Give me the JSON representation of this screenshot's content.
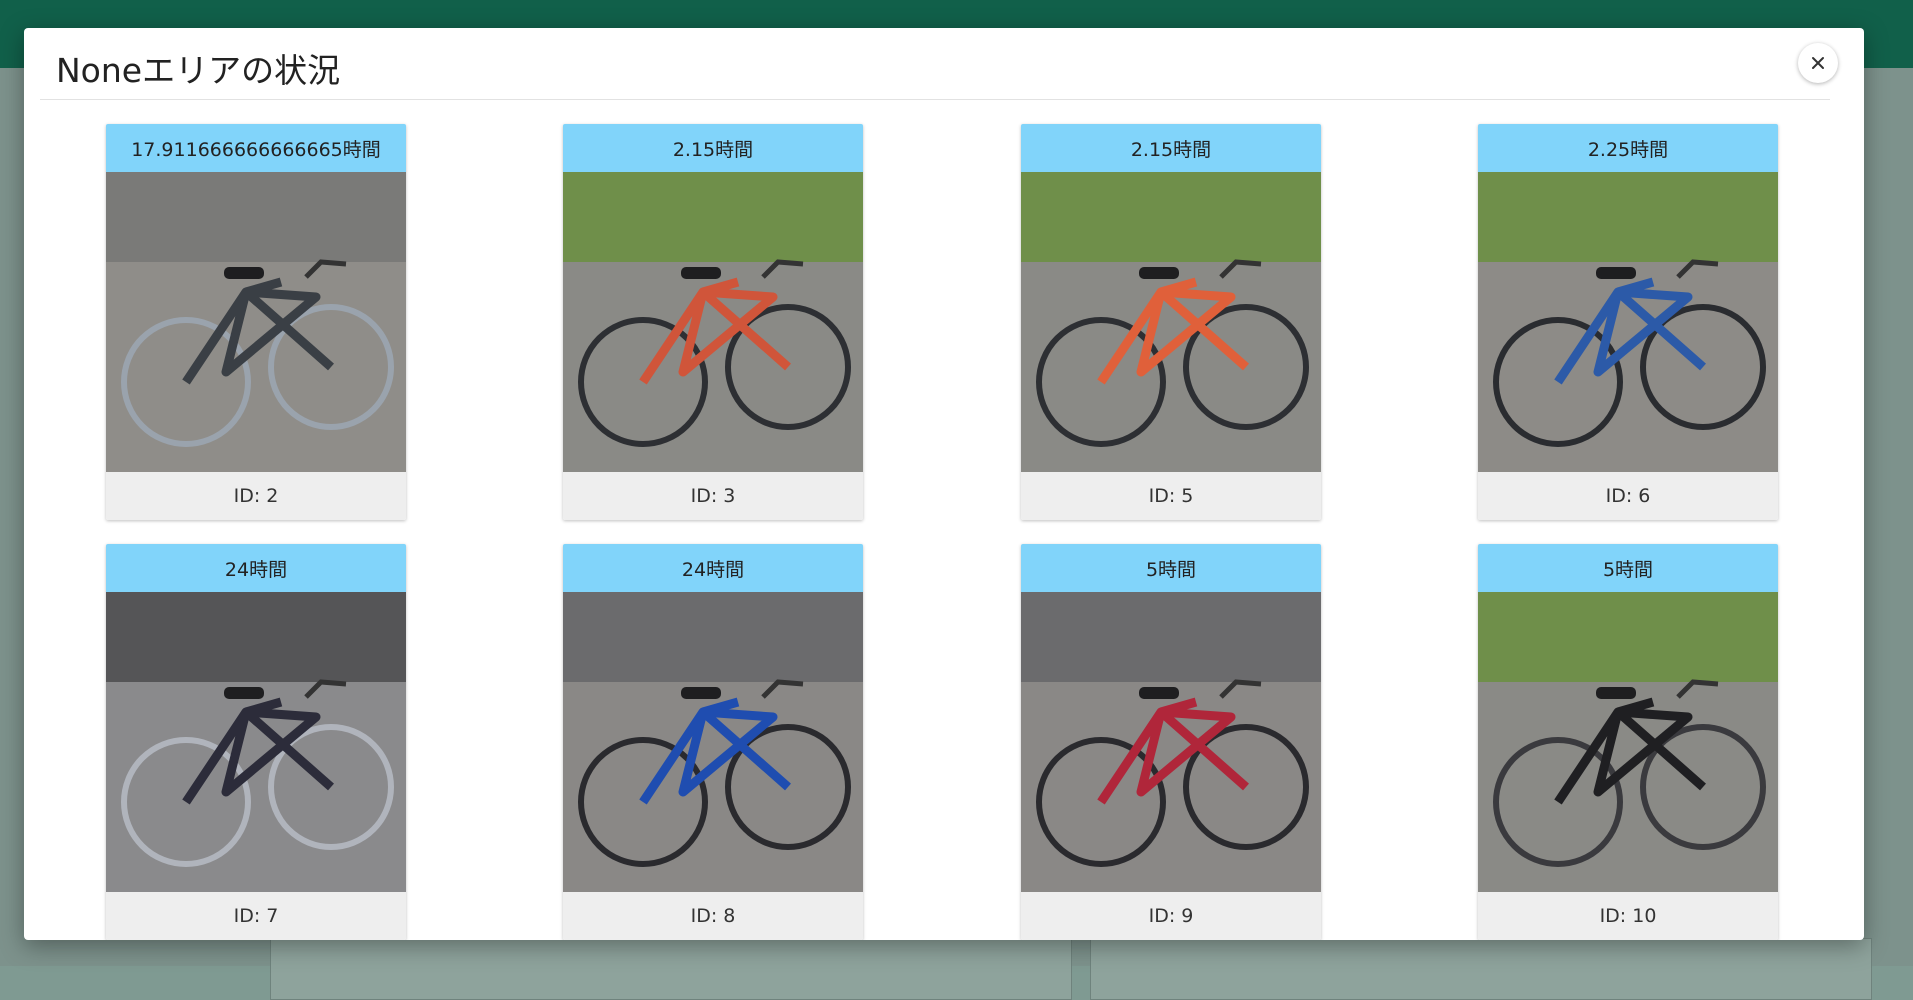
{
  "app": {
    "header_text": ""
  },
  "modal": {
    "title": "Noneエリアの状況",
    "close_icon": "close-icon"
  },
  "cards": [
    {
      "duration": "17.911666666666665時間",
      "id_label": "ID: 2",
      "image": "bicycle-photo"
    },
    {
      "duration": "2.15時間",
      "id_label": "ID: 3",
      "image": "bicycle-photo"
    },
    {
      "duration": "2.15時間",
      "id_label": "ID: 5",
      "image": "bicycle-photo"
    },
    {
      "duration": "2.25時間",
      "id_label": "ID: 6",
      "image": "bicycle-photo"
    },
    {
      "duration": "24時間",
      "id_label": "ID: 7",
      "image": "bicycle-photo"
    },
    {
      "duration": "24時間",
      "id_label": "ID: 8",
      "image": "bicycle-photo"
    },
    {
      "duration": "5時間",
      "id_label": "ID: 9",
      "image": "bicycle-photo"
    },
    {
      "duration": "5時間",
      "id_label": "ID: 10",
      "image": "bicycle-photo"
    }
  ],
  "colors": {
    "app_bar": "#11604a",
    "card_header": "#81d4fa",
    "card_footer": "#eeeeee"
  }
}
